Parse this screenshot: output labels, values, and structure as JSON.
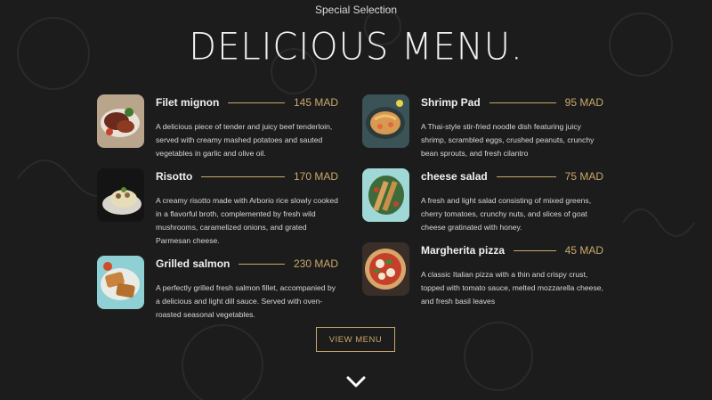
{
  "header": {
    "eyebrow": "Special Selection",
    "title": "DELICIOUS MENU."
  },
  "menu": {
    "left": [
      {
        "name": "Filet mignon",
        "price": "145 MAD",
        "description": "A delicious piece of tender and juicy beef tenderloin, served with creamy mashed potatoes and sauted vegetables in garlic and olive oil."
      },
      {
        "name": "Risotto",
        "price": "170 MAD",
        "description": "A creamy risotto made with Arborio rice slowly cooked in a flavorful broth, complemented by fresh wild mushrooms, caramelized onions, and grated Parmesan cheese."
      },
      {
        "name": "Grilled salmon",
        "price": "230 MAD",
        "description": "A perfectly grilled fresh salmon fillet, accompanied by a delicious and light dill sauce. Served with oven-roasted seasonal vegetables."
      }
    ],
    "right": [
      {
        "name": "Shrimp Pad",
        "price": "95 MAD",
        "description": "A Thai-style stir-fried noodle dish featuring juicy shrimp, scrambled eggs, crushed peanuts, crunchy bean sprouts, and fresh cilantro"
      },
      {
        "name": "cheese salad",
        "price": "75 MAD",
        "description": "A fresh and light salad consisting of mixed greens, cherry tomatoes, crunchy nuts, and slices of goat cheese gratinated with honey."
      },
      {
        "name": "Margherita pizza",
        "price": "45 MAD",
        "description": "A classic Italian pizza with a thin and crispy crust, topped with tomato sauce, melted mozzarella cheese, and fresh basil leaves"
      }
    ]
  },
  "actions": {
    "view_menu": "VIEW MENU",
    "scroll_icon": "chevron-down-icon"
  },
  "colors": {
    "background": "#1c1c1c",
    "accent": "#c9a86a",
    "text": "#e8e8e8"
  }
}
